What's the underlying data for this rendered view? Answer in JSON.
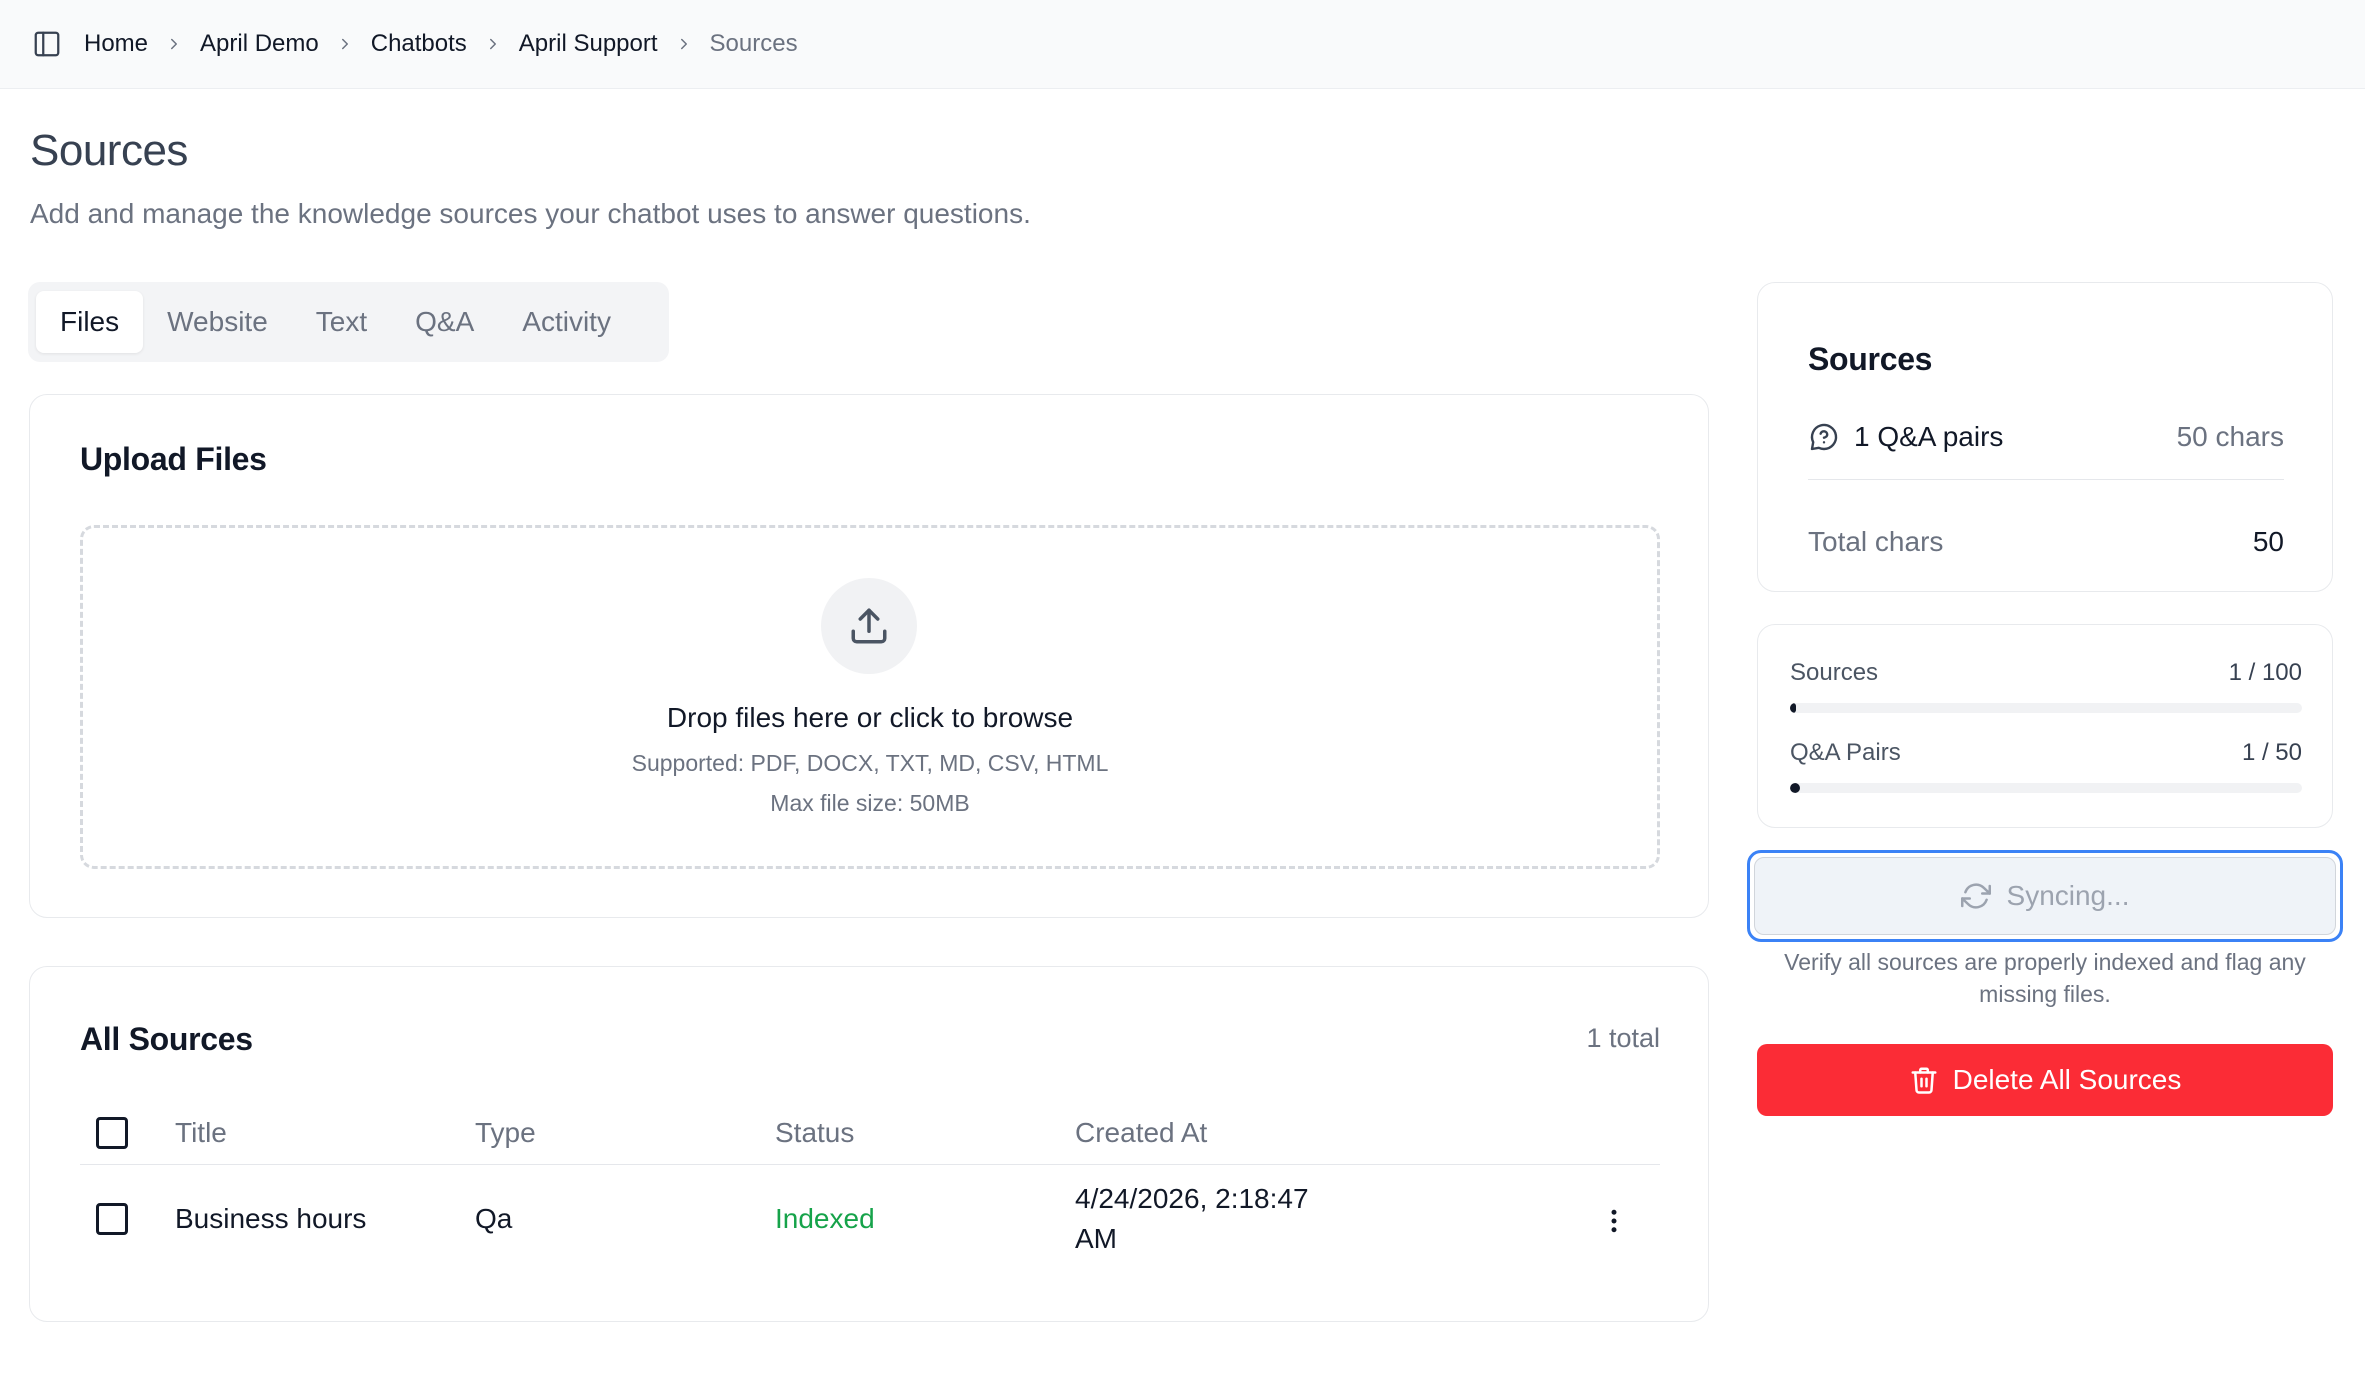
{
  "breadcrumb": {
    "items": [
      "Home",
      "April Demo",
      "Chatbots",
      "April Support"
    ],
    "current": "Sources"
  },
  "page": {
    "title": "Sources",
    "description": "Add and manage the knowledge sources your chatbot uses to answer questions."
  },
  "tabs": [
    {
      "label": "Files",
      "active": true
    },
    {
      "label": "Website",
      "active": false
    },
    {
      "label": "Text",
      "active": false
    },
    {
      "label": "Q&A",
      "active": false
    },
    {
      "label": "Activity",
      "active": false
    }
  ],
  "upload": {
    "title": "Upload Files",
    "drop_text": "Drop files here or click to browse",
    "supported": "Supported: PDF, DOCX, TXT, MD, CSV, HTML",
    "max_size": "Max file size: 50MB",
    "icon": "upload-icon"
  },
  "all_sources": {
    "title": "All Sources",
    "total": "1 total",
    "columns": [
      "Title",
      "Type",
      "Status",
      "Created At"
    ],
    "rows": [
      {
        "title": "Business hours",
        "type": "Qa",
        "status": "Indexed",
        "created_at": "4/24/2026, 2:18:47 AM"
      }
    ]
  },
  "summary": {
    "title": "Sources",
    "qa_label": "1 Q&A pairs",
    "qa_chars": "50 chars",
    "total_label": "Total chars",
    "total_value": "50"
  },
  "limits": [
    {
      "label": "Sources",
      "value": "1 / 100",
      "fraction": 0.01
    },
    {
      "label": "Q&A Pairs",
      "value": "1 / 50",
      "fraction": 0.02
    }
  ],
  "sync": {
    "label": "Syncing...",
    "help": "Verify all sources are properly indexed and flag any missing files."
  },
  "delete": {
    "label": "Delete All Sources"
  },
  "colors": {
    "danger": "#fb2c36",
    "success": "#16a34a",
    "focus": "#3b82f6"
  }
}
